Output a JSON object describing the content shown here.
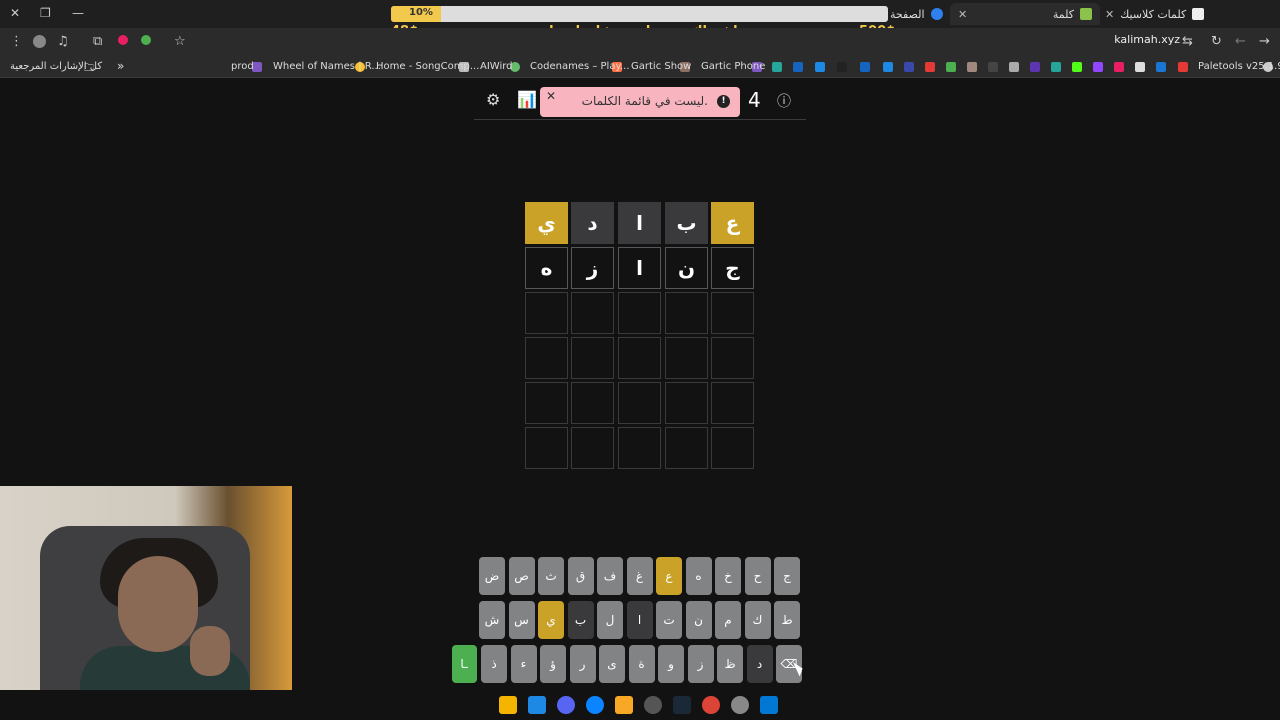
{
  "browser": {
    "tabs": [
      {
        "label": "كلمات كلاسيك",
        "active": false
      },
      {
        "label": "كلمة",
        "active": true
      },
      {
        "label": "الصفحة",
        "active": false
      }
    ],
    "url": "kalimah.xyz",
    "bookmarks": [
      "Paletools v25.1.9",
      "Gartic Phone",
      "Gartic Show",
      "Codenames – Play...",
      "AIWird",
      "Home - SongComp...",
      "Wheel of Names | R...",
      "prod",
      "كل الإشارات المرجعية"
    ]
  },
  "overlay": {
    "progress_percent": 10,
    "progress_label": "10%",
    "left_amount": "48$",
    "right_amount": "500$",
    "goal_text": "اشتراك سنة نادي عشان اعضل"
  },
  "game": {
    "guess_count": "4",
    "toast": "ليست في قائمة الكلمات.",
    "board": [
      [
        {
          "letter": "ع",
          "state": "present"
        },
        {
          "letter": "ب",
          "state": "absent"
        },
        {
          "letter": "ا",
          "state": "absent"
        },
        {
          "letter": "د",
          "state": "absent"
        },
        {
          "letter": "ي",
          "state": "present"
        }
      ],
      [
        {
          "letter": "ج",
          "state": "tbd"
        },
        {
          "letter": "ن",
          "state": "tbd"
        },
        {
          "letter": "ا",
          "state": "tbd"
        },
        {
          "letter": "ز",
          "state": "tbd"
        },
        {
          "letter": "ه",
          "state": "tbd"
        }
      ],
      [
        {
          "letter": "",
          "state": "empty"
        },
        {
          "letter": "",
          "state": "empty"
        },
        {
          "letter": "",
          "state": "empty"
        },
        {
          "letter": "",
          "state": "empty"
        },
        {
          "letter": "",
          "state": "empty"
        }
      ],
      [
        {
          "letter": "",
          "state": "empty"
        },
        {
          "letter": "",
          "state": "empty"
        },
        {
          "letter": "",
          "state": "empty"
        },
        {
          "letter": "",
          "state": "empty"
        },
        {
          "letter": "",
          "state": "empty"
        }
      ],
      [
        {
          "letter": "",
          "state": "empty"
        },
        {
          "letter": "",
          "state": "empty"
        },
        {
          "letter": "",
          "state": "empty"
        },
        {
          "letter": "",
          "state": "empty"
        },
        {
          "letter": "",
          "state": "empty"
        }
      ],
      [
        {
          "letter": "",
          "state": "empty"
        },
        {
          "letter": "",
          "state": "empty"
        },
        {
          "letter": "",
          "state": "empty"
        },
        {
          "letter": "",
          "state": "empty"
        },
        {
          "letter": "",
          "state": "empty"
        }
      ]
    ],
    "keyboard": [
      [
        {
          "k": "ج",
          "s": ""
        },
        {
          "k": "ح",
          "s": ""
        },
        {
          "k": "خ",
          "s": ""
        },
        {
          "k": "ه",
          "s": ""
        },
        {
          "k": "ع",
          "s": "present"
        },
        {
          "k": "غ",
          "s": ""
        },
        {
          "k": "ف",
          "s": ""
        },
        {
          "k": "ق",
          "s": ""
        },
        {
          "k": "ث",
          "s": ""
        },
        {
          "k": "ص",
          "s": ""
        },
        {
          "k": "ض",
          "s": ""
        }
      ],
      [
        {
          "k": "ط",
          "s": ""
        },
        {
          "k": "ك",
          "s": ""
        },
        {
          "k": "م",
          "s": ""
        },
        {
          "k": "ن",
          "s": ""
        },
        {
          "k": "ت",
          "s": ""
        },
        {
          "k": "ا",
          "s": "absent"
        },
        {
          "k": "ل",
          "s": ""
        },
        {
          "k": "ب",
          "s": "absent"
        },
        {
          "k": "ي",
          "s": "present"
        },
        {
          "k": "س",
          "s": ""
        },
        {
          "k": "ش",
          "s": ""
        }
      ],
      [
        {
          "k": "⌫",
          "s": ""
        },
        {
          "k": "د",
          "s": "absent"
        },
        {
          "k": "ظ",
          "s": ""
        },
        {
          "k": "ز",
          "s": ""
        },
        {
          "k": "و",
          "s": ""
        },
        {
          "k": "ة",
          "s": ""
        },
        {
          "k": "ى",
          "s": ""
        },
        {
          "k": "ر",
          "s": ""
        },
        {
          "k": "ؤ",
          "s": ""
        },
        {
          "k": "ء",
          "s": ""
        },
        {
          "k": "ذ",
          "s": ""
        },
        {
          "k": "ـا",
          "s": "enter"
        }
      ]
    ]
  },
  "colors": {
    "present": "#c9a227",
    "absent": "#3a3a3c",
    "enter": "#4caf50",
    "toast": "#f8b5c0"
  }
}
